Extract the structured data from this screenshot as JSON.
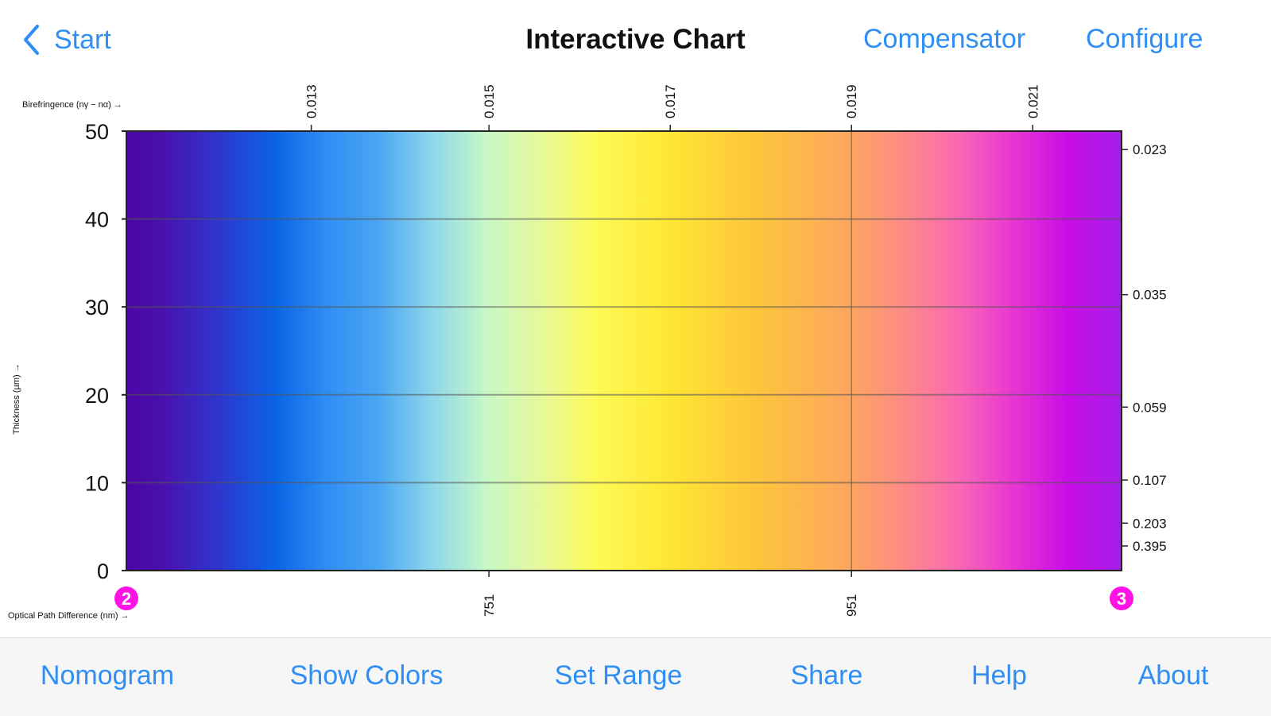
{
  "nav": {
    "back_label": "Start",
    "title": "Interactive Chart",
    "right_buttons": [
      "Compensator",
      "Configure"
    ]
  },
  "chart_data": {
    "type": "heatmap",
    "title": "",
    "top_axis_label": "Birefringence (nγ − nα) →",
    "left_axis_label": "Thickness (µm) →",
    "bottom_axis_label": "Optical Path Difference (nm) →",
    "x_range": [
      551,
      1100
    ],
    "y_range": [
      0,
      50
    ],
    "y_ticks": [
      0,
      10,
      20,
      30,
      40,
      50
    ],
    "top_ticks": [
      {
        "label": "0.013",
        "x": 653
      },
      {
        "label": "0.015",
        "x": 751
      },
      {
        "label": "0.017",
        "x": 851
      },
      {
        "label": "0.019",
        "x": 951
      },
      {
        "label": "0.021",
        "x": 1051
      }
    ],
    "bottom_ticks": [
      {
        "label": "751",
        "x": 751
      },
      {
        "label": "951",
        "x": 951
      }
    ],
    "right_ticks": [
      {
        "label": "0.023",
        "y": 47.9
      },
      {
        "label": "0.035",
        "y": 31.4
      },
      {
        "label": "0.059",
        "y": 18.6
      },
      {
        "label": "0.107",
        "y": 10.3
      },
      {
        "label": "0.203",
        "y": 5.4
      },
      {
        "label": "0.395",
        "y": 2.8
      }
    ],
    "gridlines": {
      "horizontal": [
        10,
        20,
        30,
        40
      ],
      "vertical": [
        951
      ]
    },
    "order_markers": [
      {
        "label": "2",
        "x": 551
      },
      {
        "label": "3",
        "x": 1100
      }
    ],
    "marker_color": "#ff14e6",
    "color_stops": [
      {
        "x": 551,
        "color": "#4b06a6"
      },
      {
        "x": 570,
        "color": "#4a10ab"
      },
      {
        "x": 600,
        "color": "#3033cc"
      },
      {
        "x": 633,
        "color": "#0a64e6"
      },
      {
        "x": 660,
        "color": "#2d8cf3"
      },
      {
        "x": 690,
        "color": "#4aa6f3"
      },
      {
        "x": 720,
        "color": "#8fd8ea"
      },
      {
        "x": 750,
        "color": "#c8f8c6"
      },
      {
        "x": 780,
        "color": "#e6f89a"
      },
      {
        "x": 810,
        "color": "#fefa58"
      },
      {
        "x": 850,
        "color": "#fee634"
      },
      {
        "x": 900,
        "color": "#fdc43c"
      },
      {
        "x": 950,
        "color": "#fda660"
      },
      {
        "x": 980,
        "color": "#fd8a86"
      },
      {
        "x": 1010,
        "color": "#fa68b4"
      },
      {
        "x": 1040,
        "color": "#e836d2"
      },
      {
        "x": 1070,
        "color": "#c80ee6"
      },
      {
        "x": 1100,
        "color": "#a61ee8"
      }
    ]
  },
  "toolbar": {
    "items": [
      "Nomogram",
      "Show Colors",
      "Set Range",
      "Share",
      "Help",
      "About"
    ]
  },
  "colors": {
    "accent": "#2f8ef5"
  }
}
